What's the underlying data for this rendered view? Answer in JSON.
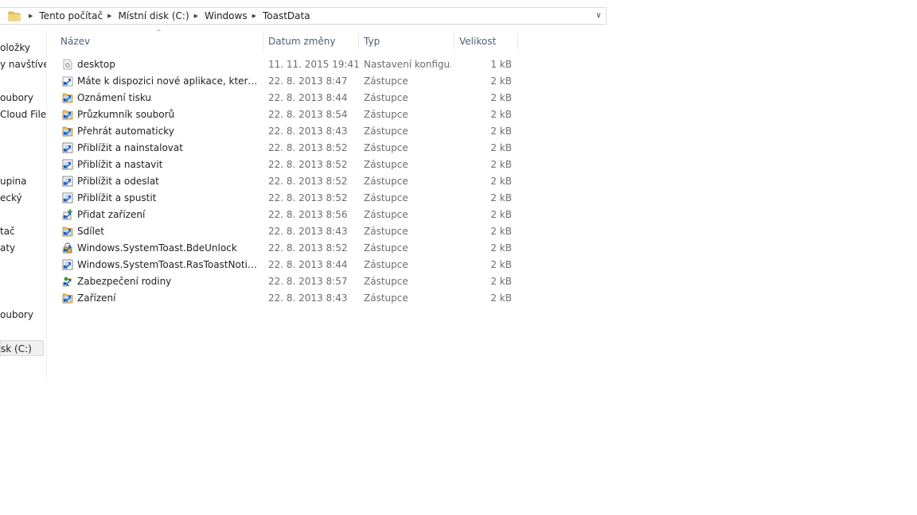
{
  "address_bar": {
    "crumbs": [
      "Tento počítač",
      "Místní disk (C:)",
      "Windows",
      "ToastData"
    ]
  },
  "nav_pane": {
    "items": [
      "oložky",
      "y navštíver",
      "oubory",
      "Cloud Files",
      "upina",
      "ecký",
      "tač",
      "aty",
      "oubory",
      "sk (C:)"
    ]
  },
  "columns": {
    "name": "Název",
    "date": "Datum změny",
    "type": "Typ",
    "size": "Velikost"
  },
  "files": [
    {
      "name": "desktop",
      "date": "11. 11. 2015 19:41",
      "type": "Nastavení konfigu...",
      "size": "1 kB",
      "icon": "settings-file-icon"
    },
    {
      "name": "Máte k dispozici nové aplikace, které mo...",
      "date": "22. 8. 2013 8:47",
      "type": "Zástupce",
      "size": "2 kB",
      "icon": "shortcut-icon"
    },
    {
      "name": "Oznámení tisku",
      "date": "22. 8. 2013 8:44",
      "type": "Zástupce",
      "size": "2 kB",
      "icon": "shortcut-folder-icon"
    },
    {
      "name": "Průzkumník souborů",
      "date": "22. 8. 2013 8:54",
      "type": "Zástupce",
      "size": "2 kB",
      "icon": "shortcut-folder-icon"
    },
    {
      "name": "Přehrát automaticky",
      "date": "22. 8. 2013 8:43",
      "type": "Zástupce",
      "size": "2 kB",
      "icon": "shortcut-folder-icon"
    },
    {
      "name": "Přiblížit a nainstalovat",
      "date": "22. 8. 2013 8:52",
      "type": "Zástupce",
      "size": "2 kB",
      "icon": "shortcut-app-icon"
    },
    {
      "name": "Přiblížit a nastavit",
      "date": "22. 8. 2013 8:52",
      "type": "Zástupce",
      "size": "2 kB",
      "icon": "shortcut-app-icon"
    },
    {
      "name": "Přiblížit a odeslat",
      "date": "22. 8. 2013 8:52",
      "type": "Zástupce",
      "size": "2 kB",
      "icon": "shortcut-app-icon"
    },
    {
      "name": "Přiblížit a spustit",
      "date": "22. 8. 2013 8:52",
      "type": "Zástupce",
      "size": "2 kB",
      "icon": "shortcut-app-icon"
    },
    {
      "name": "Přidat zařízení",
      "date": "22. 8. 2013 8:56",
      "type": "Zástupce",
      "size": "2 kB",
      "icon": "shortcut-add-icon"
    },
    {
      "name": "Sdílet",
      "date": "22. 8. 2013 8:43",
      "type": "Zástupce",
      "size": "2 kB",
      "icon": "shortcut-folder-icon"
    },
    {
      "name": "Windows.SystemToast.BdeUnlock",
      "date": "22. 8. 2013 8:52",
      "type": "Zástupce",
      "size": "2 kB",
      "icon": "shortcut-lock-icon"
    },
    {
      "name": "Windows.SystemToast.RasToastNotifier",
      "date": "22. 8. 2013 8:44",
      "type": "Zástupce",
      "size": "2 kB",
      "icon": "shortcut-app-icon"
    },
    {
      "name": "Zabezpečení rodiny",
      "date": "22. 8. 2013 8:57",
      "type": "Zástupce",
      "size": "2 kB",
      "icon": "shortcut-family-icon"
    },
    {
      "name": "Zařízení",
      "date": "22. 8. 2013 8:43",
      "type": "Zástupce",
      "size": "2 kB",
      "icon": "shortcut-folder-icon"
    }
  ],
  "colors": {
    "header_text": "#4c607a",
    "sort_arrow": "#6d8fb3",
    "meta_text": "#6d6d6d",
    "shortcut_arrow": "#1f5fbf"
  }
}
